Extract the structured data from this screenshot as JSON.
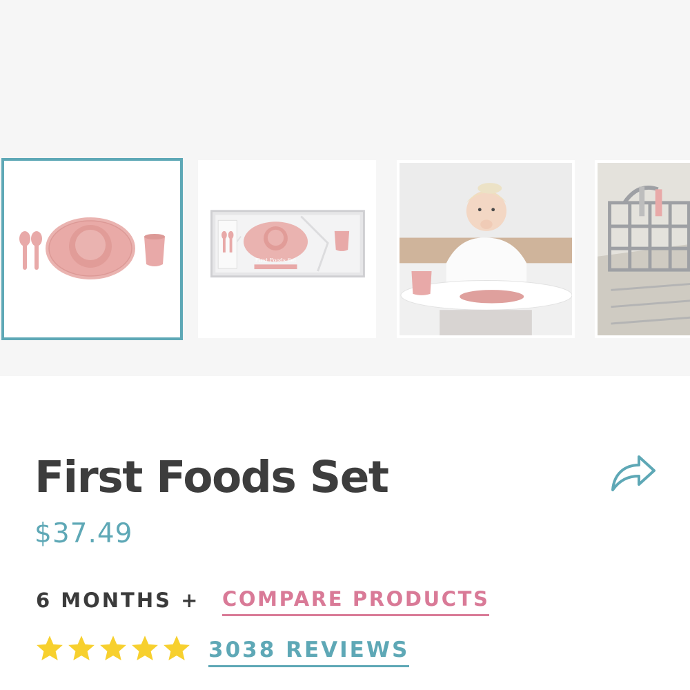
{
  "product": {
    "title": "First Foods Set",
    "price": "$37.49",
    "age_range": "6 MONTHS +",
    "compare_label": "COMPARE PRODUCTS",
    "reviews_label": "3038 REVIEWS",
    "rating": 5,
    "rating_max": 5
  },
  "gallery": {
    "selected_index": 0,
    "thumbnails": [
      {
        "name": "product-set-photo"
      },
      {
        "name": "packaging-box-photo"
      },
      {
        "name": "baby-highchair-photo"
      },
      {
        "name": "dishwasher-basket-photo"
      }
    ],
    "box_label": "First Foods Set"
  },
  "icons": {
    "share": "share-arrow-icon",
    "star": "star-icon"
  },
  "colors": {
    "accent_teal": "#5ea8b6",
    "accent_pink": "#d97a97",
    "product_pink": "#e8a9a8",
    "star_yellow": "#f7d02e",
    "title_text": "#3d3d3d",
    "gallery_bg": "#f6f6f6"
  }
}
